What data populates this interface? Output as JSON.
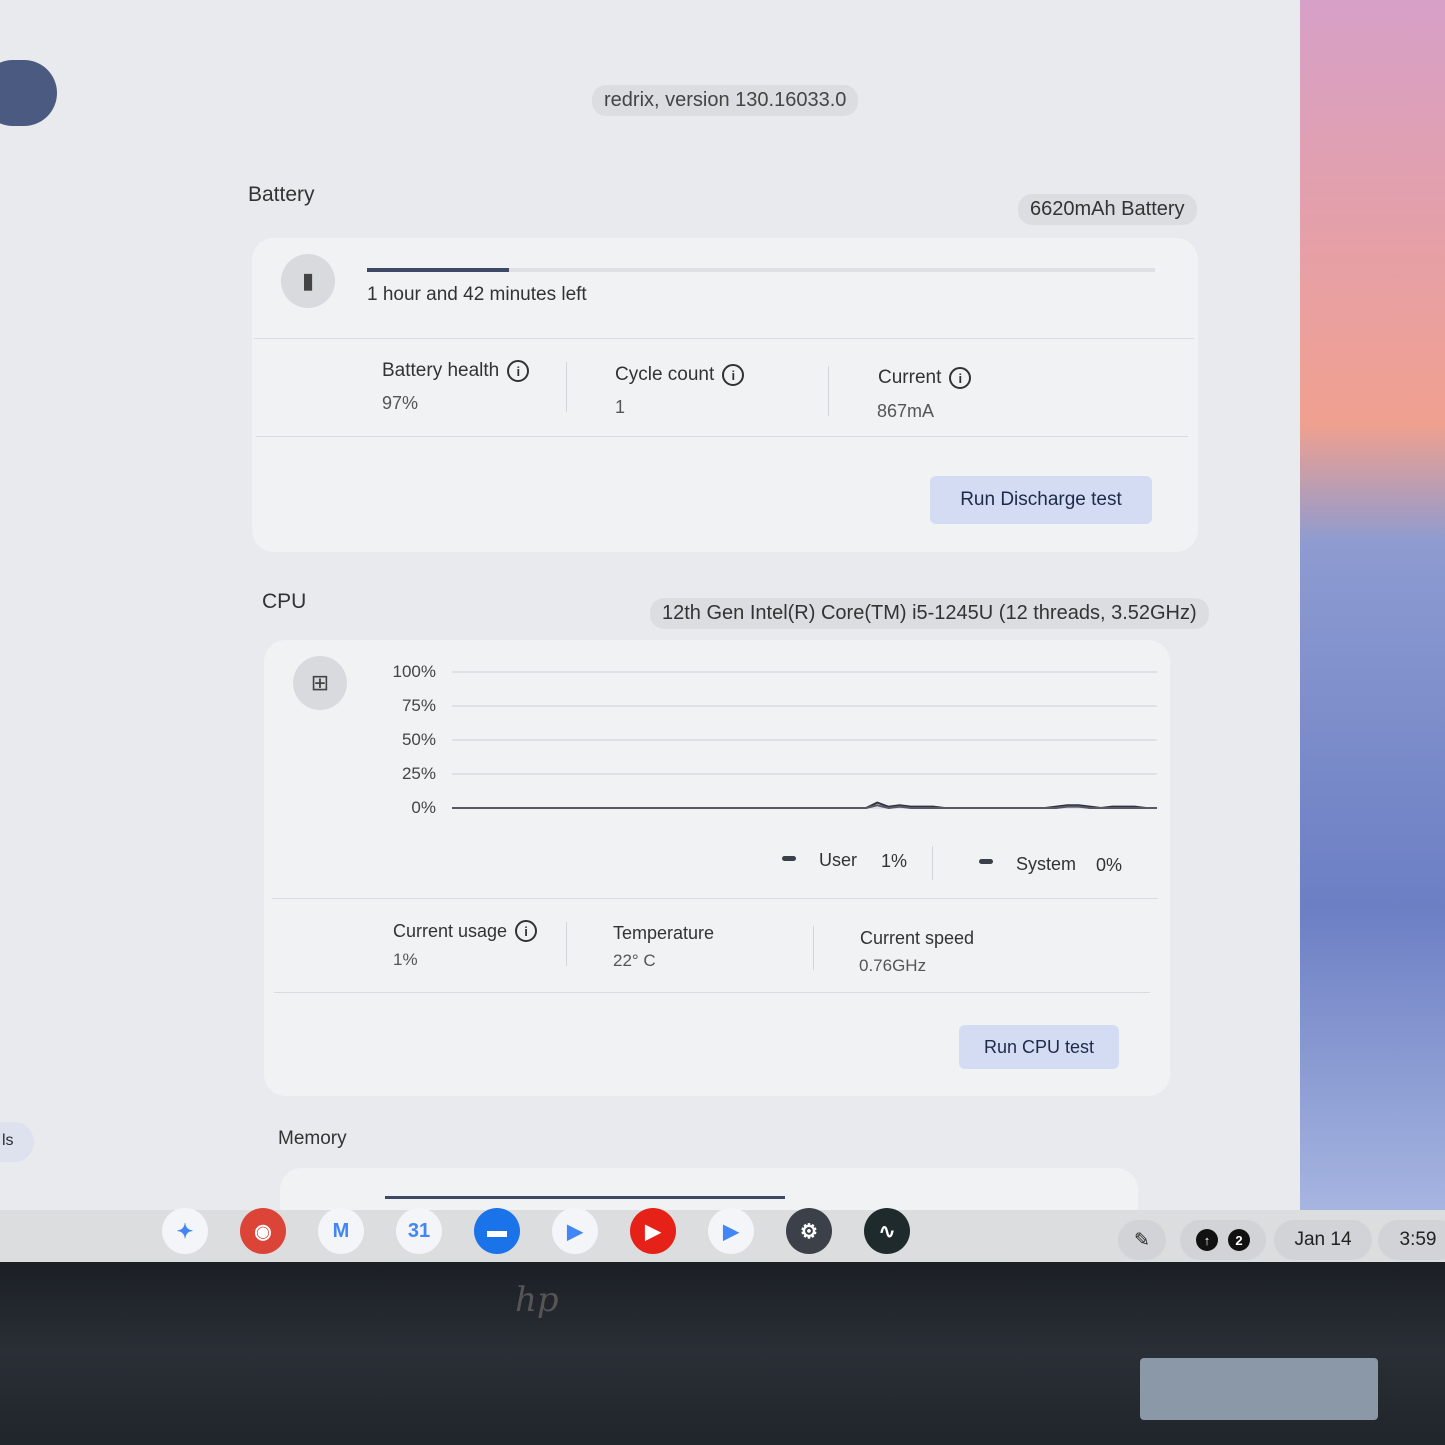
{
  "header": {
    "version": "redrix, version 130.16033.0"
  },
  "battery": {
    "title": "Battery",
    "chip": "6620mAh Battery",
    "icon": "battery-icon",
    "charge_fraction": 0.18,
    "time_left": "1 hour and 42 minutes left",
    "stats": [
      {
        "label": "Battery health",
        "value": "97%"
      },
      {
        "label": "Cycle count",
        "value": "1"
      },
      {
        "label": "Current",
        "value": "867mA"
      }
    ],
    "button": "Run Discharge test"
  },
  "cpu": {
    "title": "CPU",
    "chip": "12th Gen Intel(R) Core(TM) i5-1245U (12 threads, 3.52GHz)",
    "icon": "chip-icon",
    "chart_data": {
      "type": "line",
      "y_ticks": [
        "100%",
        "75%",
        "50%",
        "25%",
        "0%"
      ],
      "ylim": [
        0,
        100
      ],
      "grid": true,
      "series": [
        {
          "name": "User",
          "values": [
            0,
            0,
            0,
            0,
            0,
            0,
            0,
            0,
            0,
            0,
            0,
            0,
            0,
            0,
            0,
            0,
            0,
            0,
            0,
            0,
            0,
            0,
            0,
            0,
            0,
            0,
            0,
            0,
            0,
            0,
            0,
            0,
            0,
            0,
            0,
            0,
            0,
            0,
            4,
            1,
            2,
            1,
            1,
            1,
            0,
            0,
            0,
            0,
            0,
            0,
            0,
            0,
            0,
            0,
            1,
            2,
            2,
            1,
            0,
            1,
            1,
            1,
            0,
            0
          ]
        },
        {
          "name": "System",
          "values": [
            0,
            0,
            0,
            0,
            0,
            0,
            0,
            0,
            0,
            0,
            0,
            0,
            0,
            0,
            0,
            0,
            0,
            0,
            0,
            0,
            0,
            0,
            0,
            0,
            0,
            0,
            0,
            0,
            0,
            0,
            0,
            0,
            0,
            0,
            0,
            0,
            0,
            0,
            2,
            0,
            1,
            0,
            0,
            0,
            0,
            0,
            0,
            0,
            0,
            0,
            0,
            0,
            0,
            0,
            0,
            1,
            1,
            0,
            0,
            0,
            0,
            0,
            0,
            0
          ]
        }
      ]
    },
    "legend": [
      {
        "label": "User",
        "value": "1%"
      },
      {
        "label": "System",
        "value": "0%"
      }
    ],
    "stats": [
      {
        "label": "Current usage",
        "value": "1%"
      },
      {
        "label": "Temperature",
        "value": "22° C"
      },
      {
        "label": "Current speed",
        "value": "0.76GHz"
      }
    ],
    "button": "Run CPU test"
  },
  "memory": {
    "title": "Memory"
  },
  "sidebar": {
    "partial_label": "ls"
  },
  "shelf": {
    "apps": [
      {
        "name": "gemini",
        "icon": "sparkle-icon",
        "color": "#f4f5f8",
        "glyph": "✦"
      },
      {
        "name": "chrome",
        "icon": "chrome-icon",
        "color": "#db4437",
        "glyph": "◉"
      },
      {
        "name": "gmail",
        "icon": "gmail-icon",
        "color": "#f4f5f8",
        "glyph": "M"
      },
      {
        "name": "calendar",
        "icon": "calendar-icon",
        "color": "#f4f5f8",
        "glyph": "31"
      },
      {
        "name": "files",
        "icon": "folder-icon",
        "color": "#1a73e8",
        "glyph": "▬"
      },
      {
        "name": "meet",
        "icon": "meet-icon",
        "color": "#f4f5f8",
        "glyph": "▶"
      },
      {
        "name": "youtube",
        "icon": "youtube-icon",
        "color": "#e62117",
        "glyph": "▶"
      },
      {
        "name": "play-store",
        "icon": "play-store-icon",
        "color": "#f4f5f8",
        "glyph": "▶"
      },
      {
        "name": "settings",
        "icon": "gear-icon",
        "color": "#3c4048",
        "glyph": "⚙"
      },
      {
        "name": "diagnostics",
        "icon": "diagnostics-icon",
        "color": "#1f2a2c",
        "glyph": "∿"
      }
    ],
    "stylus_icon": "pen-icon",
    "notification_count": "2",
    "date": "Jan 14",
    "time": "3:59"
  }
}
